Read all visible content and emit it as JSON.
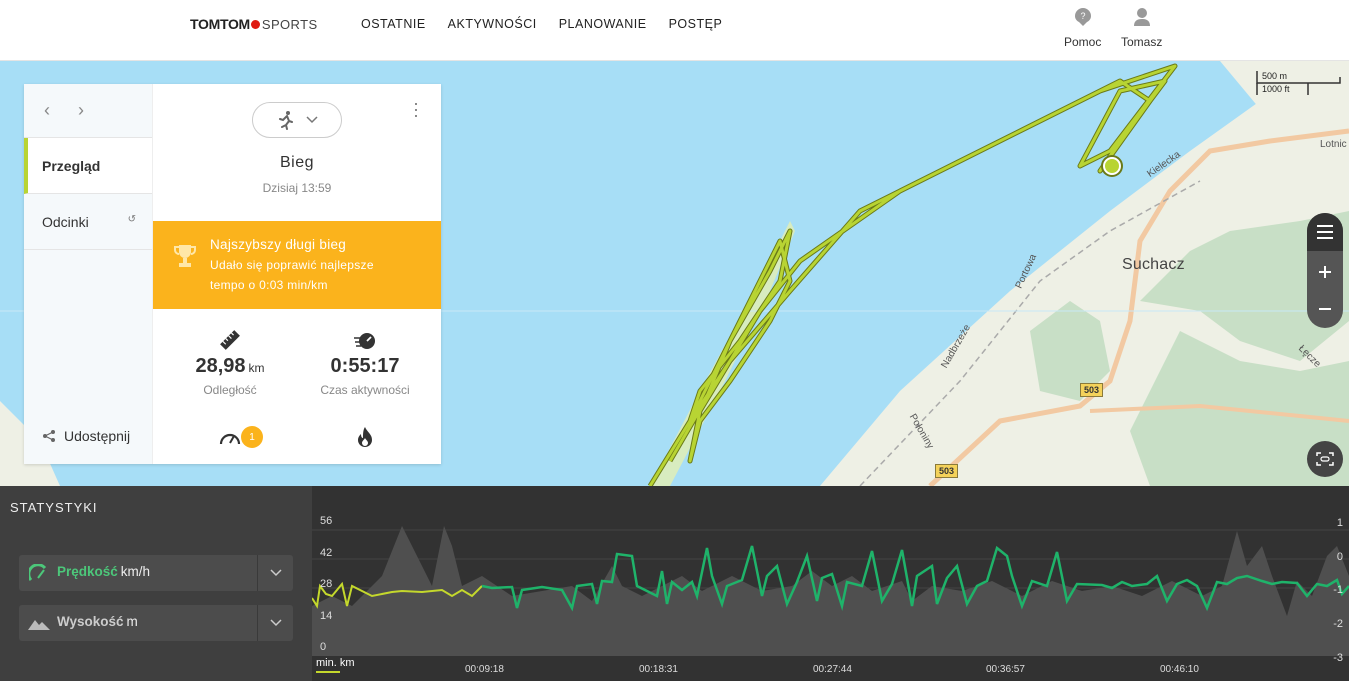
{
  "header": {
    "brand": "TOMTOM",
    "brand_sub": "SPORTS",
    "nav": [
      "OSTATNIE",
      "AKTYWNOŚCI",
      "PLANOWANIE",
      "POSTĘP"
    ],
    "help_label": "Pomoc",
    "user_label": "Tomasz"
  },
  "map": {
    "town": "Suchacz",
    "roads": [
      "Kielecka",
      "Portowa",
      "Nadbrzeże",
      "Połoniny",
      "Łęcze",
      "Lotnic"
    ],
    "road_badges": [
      "503",
      "503"
    ],
    "scale_metric": "500 m",
    "scale_imperial": "1000 ft",
    "route_color": "#b8d433",
    "water_color": "#a7def6"
  },
  "panel": {
    "tabs": [
      "Przegląd",
      "Odcinki"
    ],
    "share_label": "Udostępnij",
    "activity_type": "Bieg",
    "activity_date": "Dzisiaj 13:59",
    "achievement": {
      "title": "Najszybszy długi bieg",
      "line1": "Udało się poprawić najlepsze",
      "line2": "tempo o 0:03 min/km"
    },
    "distance": {
      "value": "28,98",
      "unit": "km",
      "label": "Odległość"
    },
    "duration": {
      "value": "0:55:17",
      "label": "Czas aktywności"
    },
    "pace_badge": "1"
  },
  "stats": {
    "title": "STATYSTYKI",
    "metric1": {
      "name": "Prędkość",
      "unit": "km/h",
      "color": "#4cc77a"
    },
    "metric2": {
      "name": "Wysokość",
      "unit": "m",
      "color": "#cccccc"
    },
    "left_axis": [
      "56",
      "42",
      "28",
      "14",
      "0"
    ],
    "right_axis": [
      "1",
      "0",
      "-1",
      "-2",
      "-3"
    ],
    "x_unit": "min. km",
    "x_ticks": [
      "00:09:18",
      "00:18:31",
      "00:27:44",
      "00:36:57",
      "00:46:10"
    ]
  }
}
